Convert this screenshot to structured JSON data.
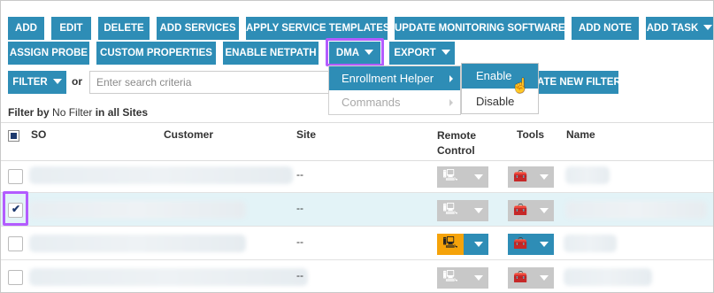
{
  "toolbar": {
    "row1": [
      "ADD",
      "EDIT",
      "DELETE",
      "ADD SERVICES",
      "APPLY SERVICE TEMPLATES",
      "UPDATE MONITORING SOFTWARE",
      "ADD NOTE",
      "ADD TASK"
    ],
    "row2": [
      "ASSIGN PROBE",
      "CUSTOM PROPERTIES",
      "ENABLE NETPATH",
      "DMA",
      "EXPORT"
    ]
  },
  "filter": {
    "button": "FILTER",
    "or": "or",
    "search_placeholder": "Enter search criteria",
    "create_label": "ATE NEW FILTER",
    "filter_by_label": "Filter by",
    "filter_by_value": "No Filter",
    "filter_in": "in all",
    "filter_scope": "Sites"
  },
  "dma_menu": {
    "items": [
      "Enrollment Helper",
      "Commands"
    ],
    "submenu": [
      "Enable",
      "Disable"
    ]
  },
  "table": {
    "columns": [
      "SO",
      "Customer",
      "Site",
      "Remote Control",
      "Tools",
      "Name"
    ],
    "rows": [
      {
        "site": "--",
        "checked": false,
        "active": false
      },
      {
        "site": "--",
        "checked": true,
        "active": false
      },
      {
        "site": "--",
        "checked": false,
        "active": true
      },
      {
        "site": "--",
        "checked": false,
        "active": false
      }
    ]
  },
  "colors": {
    "accent": "#2e8db6",
    "highlight": "#b35cff",
    "selected_row": "#e3f3f7",
    "remote_active": "#f5a30a"
  }
}
